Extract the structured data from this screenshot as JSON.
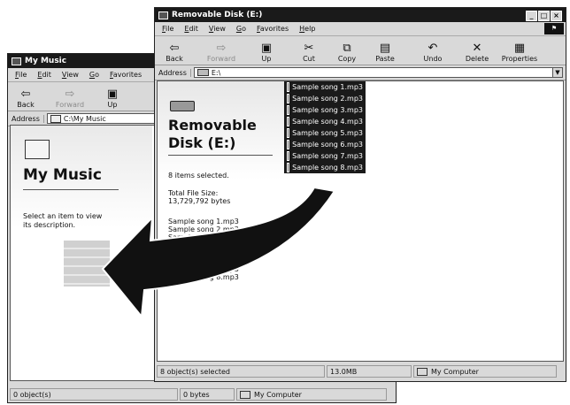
{
  "my_music": {
    "title": "My Music",
    "menu": [
      "File",
      "Edit",
      "View",
      "Go",
      "Favorites"
    ],
    "toolbar": {
      "back": "Back",
      "forward": "Forward",
      "up": "Up"
    },
    "address_label": "Address",
    "address_value": "C:\\My Music",
    "panel_title": "My Music",
    "panel_desc": "Select an item to view its description.",
    "status": {
      "objects": "0 object(s)",
      "size": "0 bytes",
      "location": "My Computer"
    }
  },
  "removable": {
    "title": "Removable Disk (E:)",
    "menu": [
      "File",
      "Edit",
      "View",
      "Go",
      "Favorites",
      "Help"
    ],
    "toolbar": {
      "back": "Back",
      "forward": "Forward",
      "up": "Up",
      "cut": "Cut",
      "copy": "Copy",
      "paste": "Paste",
      "undo": "Undo",
      "delete": "Delete",
      "properties": "Properties"
    },
    "address_label": "Address",
    "address_value": "E:\\",
    "panel_title_line1": "Removable",
    "panel_title_line2": "Disk (E:)",
    "selected_text": "8 items selected.",
    "total_size_label": "Total File Size:",
    "total_size_value": "13,729,792 bytes",
    "files": [
      "Sample song 1.mp3",
      "Sample song 2.mp3",
      "Sample song 3.mp3",
      "Sample song 4.mp3",
      "Sample song 5.mp3",
      "Sample song 6.mp3",
      "Sample song 7.mp3",
      "Sample song 8.mp3"
    ],
    "list_below": [
      "Sample song 1.mp3",
      "Sample song 2.mp3",
      "Sample song 3.mp3",
      "Sample song 4.mp3",
      "Sample song 5.mp3",
      "Sample song 6.mp3",
      "Sample song 7.mp3",
      "Sample song 8.mp3"
    ],
    "status": {
      "objects": "8 object(s) selected",
      "size": "13.0MB",
      "location": "My Computer"
    }
  }
}
